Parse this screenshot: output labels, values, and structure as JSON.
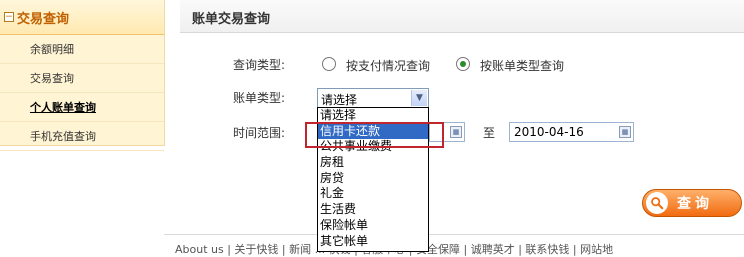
{
  "sidebar": {
    "title": "交易查询",
    "items": [
      {
        "label": "余额明细"
      },
      {
        "label": "交易查询"
      },
      {
        "label": "个人账单查询"
      },
      {
        "label": "手机充值查询"
      }
    ]
  },
  "main": {
    "title": "账单交易查询",
    "query_type_label": "查询类型:",
    "radio_payment": "按支付情况查询",
    "radio_bill_type": "按账单类型查询",
    "bill_type_label": "账单类型:",
    "select_value": "请选择",
    "date_label": "时间范围:",
    "to_label": "至",
    "date_end": "2010-04-16",
    "dropdown_options": [
      "请选择",
      "信用卡还款",
      "公共事业缴费",
      "房租",
      "房贷",
      "礼金",
      "生活费",
      "保险帐单",
      "其它帐单"
    ],
    "selected_option": "信用卡还款",
    "search_button": "查询",
    "footer_text": "About us | 关于快钱 | 新闻 ... 快钱 | 客服中心 | 安全保障 | 诚聘英才 | 联系快钱 | 网站地"
  },
  "colors": {
    "accent": "#f16b11",
    "selection": "#316ac5",
    "highlight_border": "#c0262d"
  }
}
